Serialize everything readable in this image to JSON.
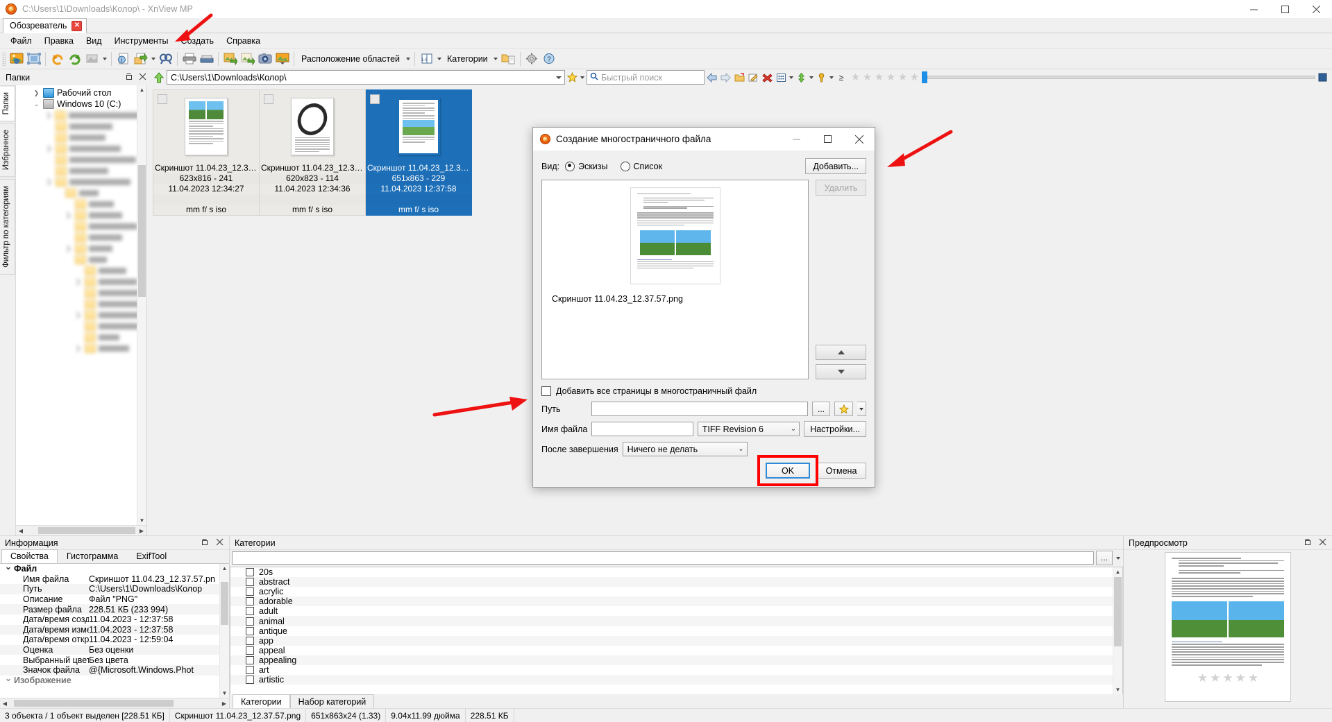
{
  "window": {
    "title": "C:\\Users\\1\\Downloads\\Колор\\ - XnView MP",
    "app_icon": "xnview-flame-icon",
    "minimize": "–",
    "maximize": "□",
    "close": "✕"
  },
  "doc_tab": {
    "label": "Обозреватель",
    "close": "✕"
  },
  "menu": {
    "items": [
      "Файл",
      "Правка",
      "Вид",
      "Инструменты",
      "Создать",
      "Справка"
    ]
  },
  "toolbar": {
    "labels": {
      "layout": "Расположение областей",
      "categories": "Категории"
    },
    "icons": [
      "open-image-icon",
      "fit-window-icon",
      "rotate-left-icon",
      "rotate-right-icon",
      "convert-icon",
      "info-icon",
      "export-icon",
      "find-icon",
      "print-icon",
      "scanner-icon",
      "batch-convert-icon",
      "batch-rename-icon",
      "screen-capture-icon",
      "slideshow-icon",
      "pages-layout-icon",
      "categories-folder-icon",
      "settings-gear-icon",
      "help-icon"
    ]
  },
  "address": {
    "folders_panel_title": "Папки",
    "path": "C:\\Users\\1\\Downloads\\Колор\\",
    "search_placeholder": "Быстрый поиск",
    "star_count": 6,
    "icons": [
      "up-folder-icon",
      "favorite-star-icon",
      "search-magnifier-icon",
      "back-arrow-icon",
      "forward-arrow-icon",
      "new-folder-icon",
      "rename-icon",
      "delete-red-x-icon",
      "thumbnail-size-icon",
      "sort-icon",
      "filter-icon",
      "compare-icon"
    ]
  },
  "vertical_tabs": {
    "items": [
      "Папки",
      "Избранное",
      "Фильтр по категориям"
    ],
    "active": "Папки"
  },
  "tree": {
    "items": [
      {
        "label": "Рабочий стол",
        "icon": "desktop-icon",
        "expanded": false,
        "blurred": false,
        "indent": 0
      },
      {
        "label": "Windows 10 (C:)",
        "icon": "drive-icon",
        "expanded": true,
        "blurred": false,
        "indent": 0
      }
    ],
    "blurred_rows": 22
  },
  "thumbnails": {
    "items": [
      {
        "name": "Скриншот 11.04.23_12.34....",
        "dims": "623x816 - 241",
        "datetime": "11.04.2023 12:34:27",
        "exif": "mm f/ s iso",
        "selected": false,
        "kind": "doc-two-images"
      },
      {
        "name": "Скриншот 11.04.23_12.34....",
        "dims": "620x823 - 114",
        "datetime": "11.04.2023 12:34:36",
        "exif": "mm f/ s iso",
        "selected": false,
        "kind": "doc-ring"
      },
      {
        "name": "Скриншот 11.04.23_12.37....",
        "dims": "651x863 - 229",
        "datetime": "11.04.2023 12:37:58",
        "exif": "mm f/ s iso",
        "selected": true,
        "kind": "doc-landscape"
      }
    ]
  },
  "dialog": {
    "title": "Создание многостраничного файла",
    "icon": "xnview-flame-icon",
    "minimize": "–",
    "maximize": "□",
    "close": "✕",
    "view_label": "Вид:",
    "view_options": [
      {
        "label": "Эскизы",
        "selected": true
      },
      {
        "label": "Список",
        "selected": false
      }
    ],
    "add_button": "Добавить...",
    "delete_button": "Удалить",
    "move_up": "▲",
    "move_down": "▼",
    "preview_filename": "Скриншот 11.04.23_12.37.57.png",
    "checkbox_label": "Добавить все страницы в многостраничный файл",
    "checkbox_checked": false,
    "path_label": "Путь",
    "path_value": "",
    "browse_button": "...",
    "favorite_button": "favorite-star-icon",
    "filename_label": "Имя файла",
    "filename_value": "",
    "format_value": "TIFF Revision 6",
    "settings_button": "Настройки...",
    "after_label": "После завершения",
    "after_value": "Ничего не делать",
    "ok_button": "OK",
    "cancel_button": "Отмена",
    "highlight_color": "#ff0000",
    "ok_focus_color": "#2f8ad4"
  },
  "info_panel": {
    "title": "Информация",
    "tabs": [
      {
        "label": "Свойства",
        "active": true
      },
      {
        "label": "Гистограмма",
        "active": false
      },
      {
        "label": "ExifTool",
        "active": false
      }
    ],
    "groups": [
      {
        "name": "Файл"
      }
    ],
    "rows": [
      {
        "key": "Имя файла",
        "value": "Скриншот 11.04.23_12.37.57.pn"
      },
      {
        "key": "Путь",
        "value": "C:\\Users\\1\\Downloads\\Колор"
      },
      {
        "key": "Описание",
        "value": "Файл \"PNG\""
      },
      {
        "key": "Размер файла",
        "value": "228.51 КБ (233 994)"
      },
      {
        "key": "Дата/время создания",
        "value": "11.04.2023 - 12:37:58"
      },
      {
        "key": "Дата/время изменения",
        "value": "11.04.2023 - 12:37:58"
      },
      {
        "key": "Дата/время открытия",
        "value": "11.04.2023 - 12:59:04"
      },
      {
        "key": "Оценка",
        "value": "Без оценки"
      },
      {
        "key": "Выбранный цвет",
        "value": "Без цвета"
      },
      {
        "key": "Значок файла",
        "value": "@{Microsoft.Windows.Phot"
      }
    ],
    "next_group": "Изображение"
  },
  "categories_panel": {
    "title": "Категории",
    "search_value": "",
    "items": [
      "20s",
      "abstract",
      "acrylic",
      "adorable",
      "adult",
      "animal",
      "antique",
      "app",
      "appeal",
      "appealing",
      "art",
      "artistic"
    ],
    "footer_tabs": [
      {
        "label": "Категории",
        "active": true
      },
      {
        "label": "Набор категорий",
        "active": false
      }
    ]
  },
  "preview_panel": {
    "title": "Предпросмотр",
    "star_count": 5
  },
  "status_bar": {
    "segments": [
      "3 объекта / 1 объект выделен [228.51 КБ]",
      "Скриншот 11.04.23_12.37.57.png",
      "651x863x24 (1.33)",
      "9.04x11.99 дюйма",
      "228.51 КБ"
    ]
  },
  "annotations": {
    "arrow_color": "#ee1111",
    "arrows": [
      {
        "name": "arrow-to-sozdat-menu"
      },
      {
        "name": "arrow-to-add-button"
      },
      {
        "name": "arrow-to-all-pages-checkbox"
      }
    ]
  }
}
